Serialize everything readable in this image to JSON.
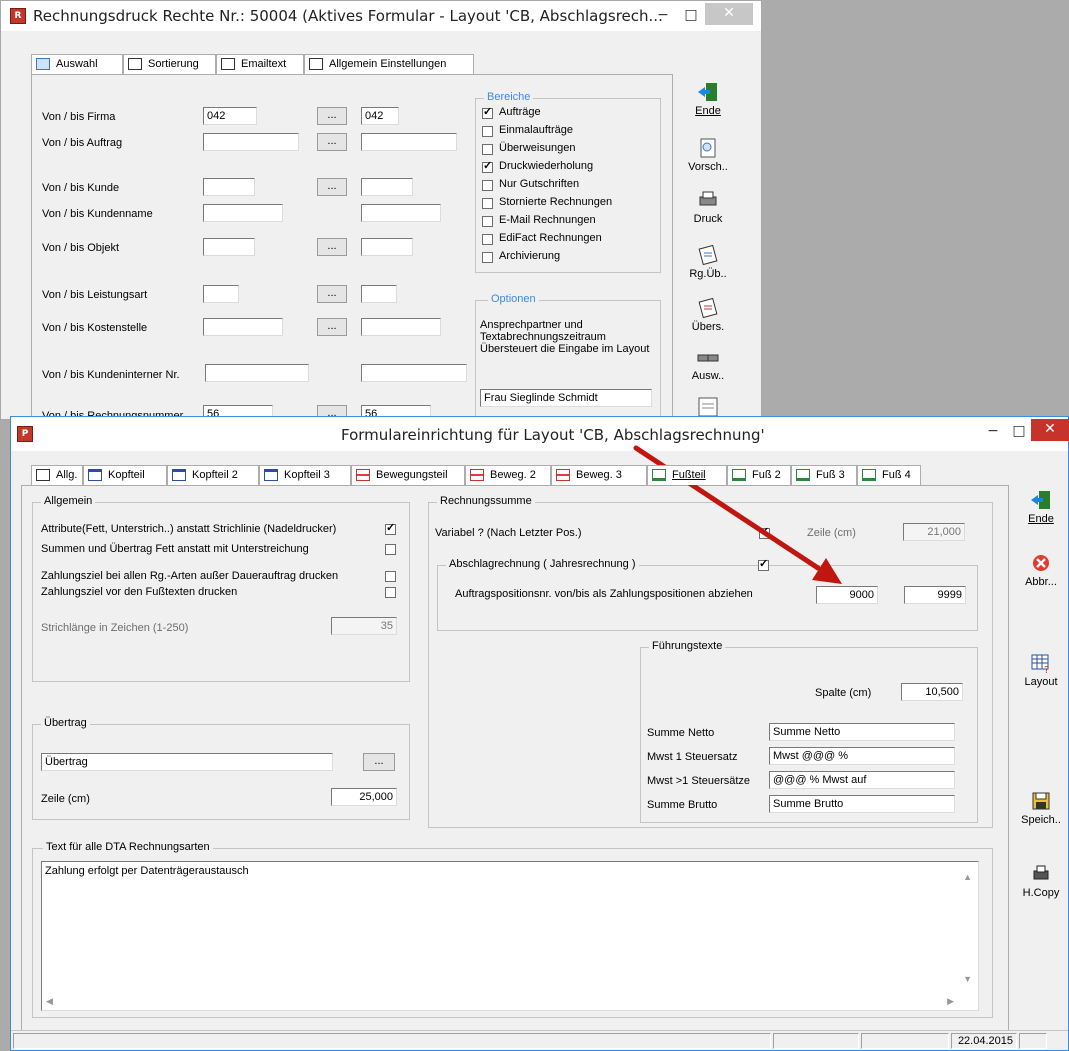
{
  "back_window": {
    "title": "Rechnungsdruck Rechte Nr.: 50004  (Aktives Formular - Layout 'CB, Abschlagsrech...",
    "tabs": [
      "Auswahl",
      "Sortierung",
      "Emailtext",
      "Allgemein Einstellungen"
    ],
    "rows": [
      {
        "label": "Von / bis Firma",
        "from": "042",
        "to": "042"
      },
      {
        "label": "Von / bis Auftrag",
        "from": "",
        "to": ""
      },
      {
        "label": "Von / bis Kunde",
        "from": "",
        "to": ""
      },
      {
        "label": "Von / bis Kundenname",
        "from": "",
        "to": ""
      },
      {
        "label": "Von / bis Objekt",
        "from": "",
        "to": ""
      },
      {
        "label": "Von / bis Leistungsart",
        "from": "",
        "to": ""
      },
      {
        "label": "Von / bis Kostenstelle",
        "from": "",
        "to": ""
      },
      {
        "label": "Von / bis Kundeninterner Nr.",
        "from": "",
        "to": ""
      },
      {
        "label": "Von / bis Rechnungsnummer",
        "from": "56",
        "to": "56"
      }
    ],
    "dots": "...",
    "bereiche_title": "Bereiche",
    "bereiche": [
      {
        "label": "Aufträge",
        "checked": true
      },
      {
        "label": "Einmalaufträge",
        "checked": false
      },
      {
        "label": "Überweisungen",
        "checked": false
      },
      {
        "label": "Druckwiederholung",
        "checked": true
      },
      {
        "label": "Nur Gutschriften",
        "checked": false
      },
      {
        "label": "Stornierte Rechnungen",
        "checked": false
      },
      {
        "label": "E-Mail Rechnungen",
        "checked": false
      },
      {
        "label": "EdiFact Rechnungen",
        "checked": false
      },
      {
        "label": "Archivierung",
        "checked": false
      }
    ],
    "optionen_title": "Optionen",
    "optionen_text": "Ansprechpartner und Textabrechnungszeitraum Übersteuert die Eingabe im Layout",
    "ansprechpartner": "Frau Sieglinde Schmidt",
    "tools": [
      "Ende",
      "Vorsch..",
      "Druck",
      "Rg.Üb..",
      "Übers.",
      "Ausw.."
    ]
  },
  "front_window": {
    "title": "Formulareinrichtung für Layout 'CB, Abschlagsrechnung'",
    "tabs": [
      "Allg.",
      "Kopfteil",
      "Kopfteil 2",
      "Kopfteil 3",
      "Bewegungsteil",
      "Beweg. 2",
      "Beweg. 3",
      "Fußteil",
      "Fuß 2",
      "Fuß 3",
      "Fuß 4"
    ],
    "allgemein": {
      "title": "Allgemein",
      "options": [
        {
          "label": "Attribute(Fett, Unterstrich..) anstatt Strichlinie (Nadeldrucker)",
          "checked": true
        },
        {
          "label": "Summen und Übertrag Fett anstatt mit Unterstreichung",
          "checked": false
        },
        {
          "label": "Zahlungsziel bei allen Rg.-Arten außer Dauerauftrag drucken",
          "checked": false
        },
        {
          "label": "Zahlungsziel vor den Fußtexten drucken",
          "checked": false
        }
      ],
      "strichlaenge_label": "Strichlänge in Zeichen  (1-250)",
      "strichlaenge_value": "35"
    },
    "uebertrag": {
      "title": "Übertrag",
      "value": "Übertrag",
      "dots": "...",
      "zeile_label": "Zeile (cm)",
      "zeile_value": "25,000"
    },
    "rechnungssumme": {
      "title": "Rechnungssumme",
      "variabel_label": "Variabel ? (Nach Letzter Pos.)",
      "variabel_checked": true,
      "zeile_label": "Zeile (cm)",
      "zeile_value": "21,000",
      "abschlag_title": "Abschlagrechnung ( Jahresrechnung )",
      "abschlag_checked": true,
      "auftrag_label": "Auftragspositionsnr. von/bis als Zahlungspositionen abziehen",
      "auftrag_from": "9000",
      "auftrag_to": "9999"
    },
    "fuehrungstexte": {
      "title": "Führungstexte",
      "spalte_label": "Spalte (cm)",
      "spalte_value": "10,500",
      "rows": [
        {
          "label": "Summe Netto",
          "value": "Summe Netto"
        },
        {
          "label": "Mwst 1 Steuersatz",
          "value": "Mwst @@@ %"
        },
        {
          "label": "Mwst >1 Steuersätze",
          "value": "@@@ % Mwst auf"
        },
        {
          "label": "Summe Brutto",
          "value": "Summe Brutto"
        }
      ]
    },
    "dta": {
      "title": "Text für alle DTA Rechnungsarten",
      "text": "Zahlung erfolgt per Datenträgeraustausch"
    },
    "tools": [
      "Ende",
      "Abbr...",
      "Layout",
      "Speich..",
      "H.Copy"
    ],
    "status_date": "22.04.2015"
  },
  "colors": {
    "accent_arrow": "#c0160f",
    "close_red": "#c7322b"
  }
}
